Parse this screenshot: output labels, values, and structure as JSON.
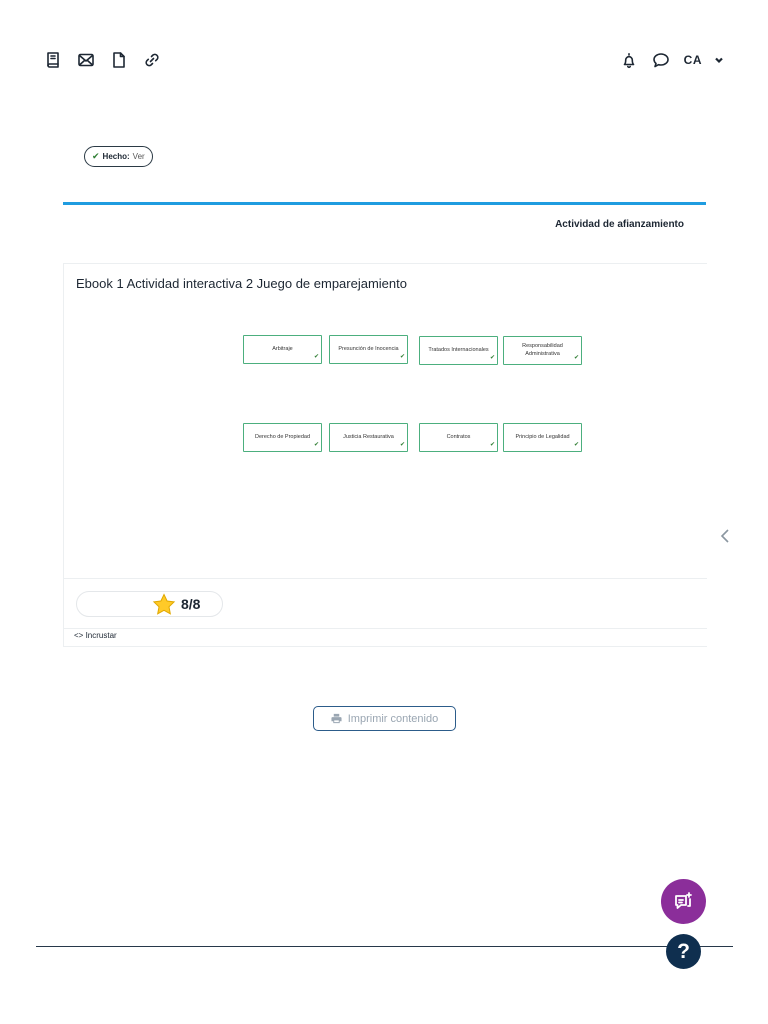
{
  "header": {
    "left_icons": [
      "book-icon",
      "mail-icon",
      "document-icon",
      "link-icon"
    ],
    "right_icons": [
      "bell-icon",
      "chat-bubble-icon"
    ],
    "language": "CA"
  },
  "status": {
    "done_label": "Hecho:",
    "done_value": "Ver"
  },
  "section": {
    "title": "Actividad de afianzamiento",
    "accent_color": "#1f9ce0"
  },
  "activity": {
    "title": "Ebook 1 Actividad interactiva 2 Juego de emparejamiento",
    "cards": [
      "Arbitraje",
      "Presunción de Inocencia",
      "Tratados Internacionales",
      "Responsabilidad Administrativa",
      "Derecho de Propiedad",
      "Justicia Restaurativa",
      "Contratos",
      "Principio de Legalidad"
    ],
    "score": "8/8",
    "embed_label": "Incrustar"
  },
  "actions": {
    "print_label": "Imprimir contenido"
  },
  "fabs": {
    "chat_color": "#8b2e9a",
    "help_label": "?",
    "help_color": "#0f2f4f"
  }
}
